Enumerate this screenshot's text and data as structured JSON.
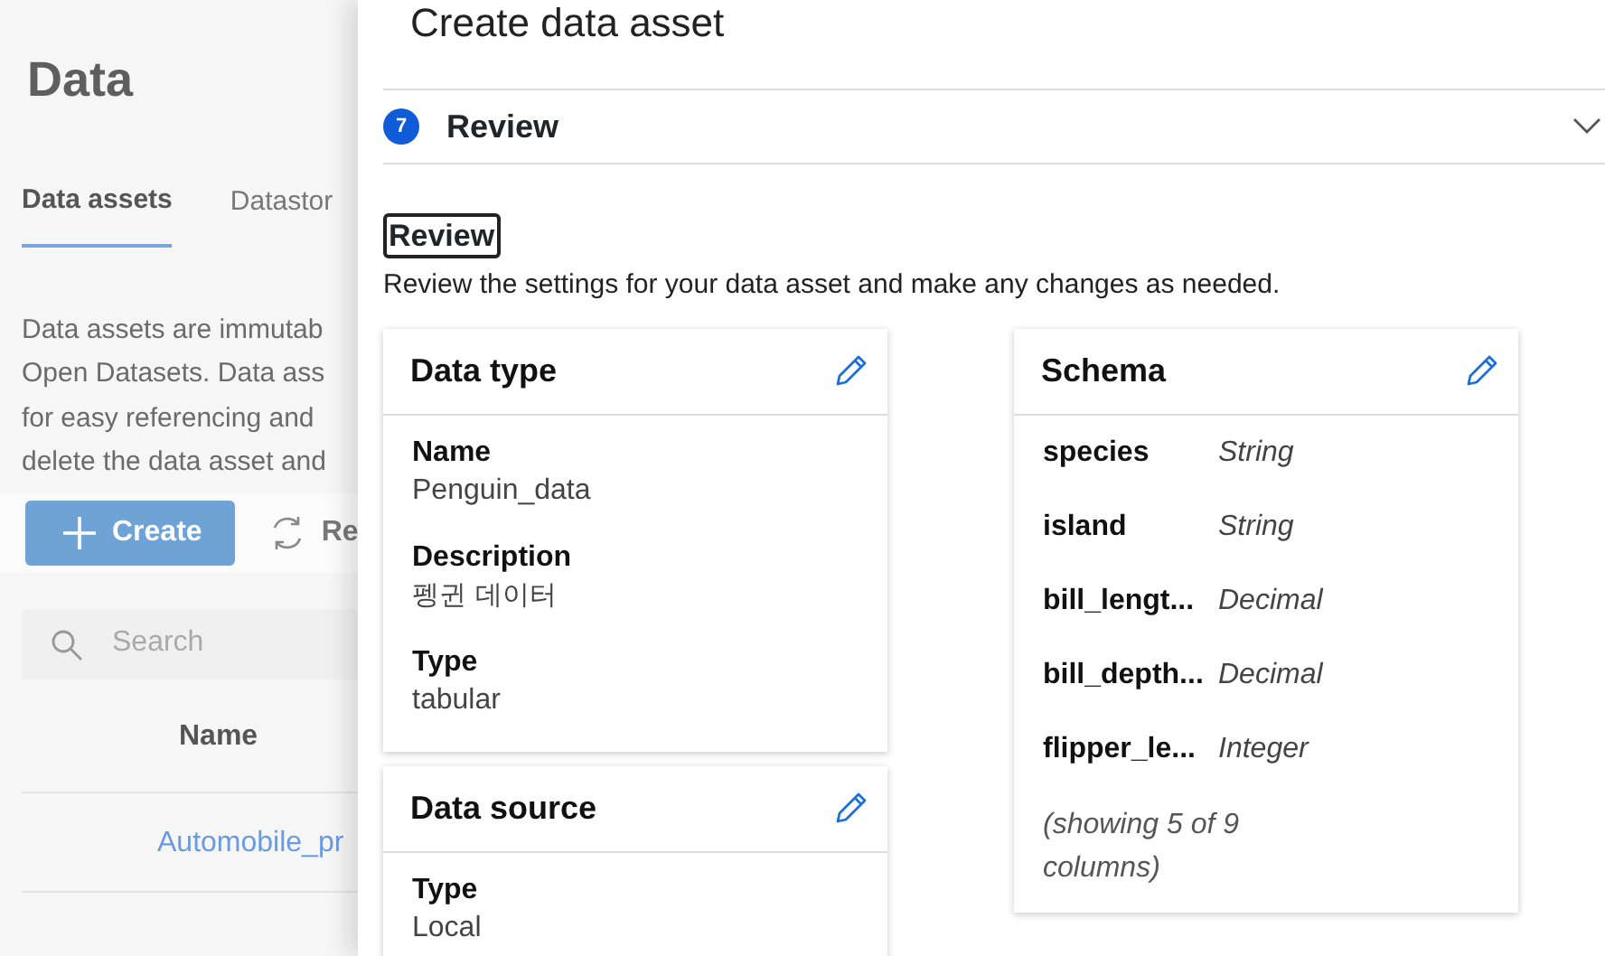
{
  "background": {
    "title": "Data",
    "tabs": [
      {
        "label": "Data assets",
        "selected": true
      },
      {
        "label": "Datastor",
        "selected": false
      }
    ],
    "description": [
      "Data assets are immutab",
      "Open Datasets. Data ass",
      "for easy referencing and",
      "delete the data asset and"
    ],
    "create_button": "Create",
    "refresh_button": "Re",
    "search": {
      "placeholder": "Search"
    },
    "table": {
      "columns": [
        "Name"
      ],
      "rows": [
        "Automobile_pr"
      ]
    }
  },
  "panel": {
    "title": "Create data asset",
    "step": {
      "number": "7",
      "label": "Review"
    },
    "section_title": "Review",
    "section_description": "Review the settings for your data asset and make any changes as needed.",
    "cards": [
      {
        "kind": "fields",
        "title": "Data type",
        "fields": [
          {
            "label": "Name",
            "value": "Penguin_data"
          },
          {
            "label": "Description",
            "value": "펭귄 데이터"
          },
          {
            "label": "Type",
            "value": "tabular"
          }
        ]
      },
      {
        "kind": "schema",
        "title": "Schema",
        "columns": [
          {
            "name": "species",
            "type": "String"
          },
          {
            "name": "island",
            "type": "String"
          },
          {
            "name": "bill_lengt...",
            "type": "Decimal"
          },
          {
            "name": "bill_depth...",
            "type": "Decimal"
          },
          {
            "name": "flipper_le...",
            "type": "Integer"
          }
        ],
        "note": "(showing 5 of 9 columns)"
      },
      {
        "kind": "fields",
        "title": "Data source",
        "fields": [
          {
            "label": "Type",
            "value": "Local"
          }
        ]
      }
    ]
  }
}
